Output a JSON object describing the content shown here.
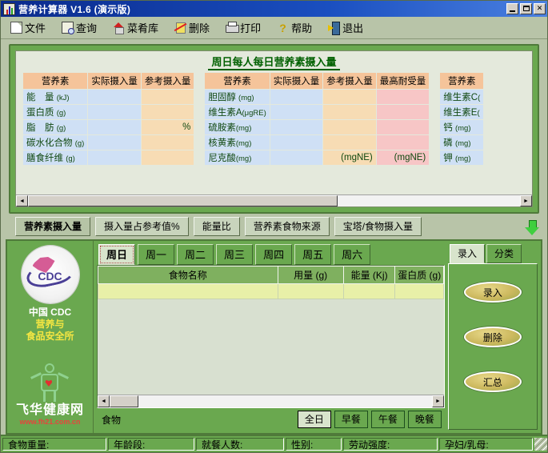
{
  "window": {
    "title": "营养计算器 V1.6 (演示版)",
    "icon": "chart-bars-icon",
    "controls": [
      {
        "name": "minimize-button",
        "label": "_"
      },
      {
        "name": "maximize-button",
        "label": "□"
      },
      {
        "name": "close-button",
        "label": "✕"
      }
    ]
  },
  "toolbar": {
    "items": [
      {
        "label": "文件",
        "icon": "file-icon"
      },
      {
        "label": "查询",
        "icon": "search-document-icon"
      },
      {
        "label": "菜肴库",
        "icon": "dish-library-icon"
      },
      {
        "label": "删除",
        "icon": "delete-icon"
      },
      {
        "label": "打印",
        "icon": "printer-icon"
      },
      {
        "label": "帮助",
        "icon": "help-icon"
      },
      {
        "label": "退出",
        "icon": "exit-icon"
      }
    ]
  },
  "nutrition_panel": {
    "title": "周日每人每日营养素摄入量",
    "tables": [
      {
        "headers": [
          "营养素",
          "实际摄入量",
          "参考摄入量"
        ],
        "rows": [
          {
            "name": "能　量",
            "unit": "(kJ)",
            "actual": "",
            "reference": ""
          },
          {
            "name": "蛋白质",
            "unit": "(g)",
            "actual": "",
            "reference": ""
          },
          {
            "name": "脂　肪",
            "unit": "(g)",
            "actual": "",
            "reference": "%"
          },
          {
            "name": "碳水化合物",
            "unit": "(g)",
            "actual": "",
            "reference": ""
          },
          {
            "name": "膳食纤维",
            "unit": "(g)",
            "actual": "",
            "reference": ""
          }
        ]
      },
      {
        "headers": [
          "营养素",
          "实际摄入量",
          "参考摄入量",
          "最高耐受量"
        ],
        "rows": [
          {
            "name": "胆固醇",
            "unit": "(mg)",
            "actual": "",
            "reference": "",
            "max": ""
          },
          {
            "name": "维生素A",
            "unit": "(μgRE)",
            "actual": "",
            "reference": "",
            "max": ""
          },
          {
            "name": "硫胺素",
            "unit": "(mg)",
            "actual": "",
            "reference": "",
            "max": ""
          },
          {
            "name": "核黄素",
            "unit": "(mg)",
            "actual": "",
            "reference": "",
            "max": ""
          },
          {
            "name": "尼克酸",
            "unit": "(mg)",
            "actual": "",
            "reference": "(mgNE)",
            "max": "(mgNE)"
          }
        ]
      },
      {
        "headers": [
          "营养素"
        ],
        "rows": [
          {
            "name": "维生素C",
            "unit": "("
          },
          {
            "name": "维生素E",
            "unit": "("
          },
          {
            "name": "钙",
            "unit": "(mg)"
          },
          {
            "name": "磷",
            "unit": "(mg)"
          },
          {
            "name": "钾",
            "unit": "(mg)"
          }
        ]
      }
    ],
    "scrollbar": {
      "left_arrow": "◄",
      "right_arrow": "►"
    }
  },
  "section_tabs": {
    "items": [
      {
        "label": "营养素摄入量",
        "active": true
      },
      {
        "label": "摄入量占参考值%",
        "active": false
      },
      {
        "label": "能量比",
        "active": false
      },
      {
        "label": "营养素食物来源",
        "active": false
      },
      {
        "label": "宝塔/食物摄入量",
        "active": false
      }
    ],
    "expand_icon": "down-arrow-icon"
  },
  "logo_panel": {
    "badge_text": "CDC",
    "caption_line1": "中国 CDC",
    "caption_line2": "营养与",
    "caption_line3": "食品安全所",
    "site_name": "飞华健康网",
    "site_url": "www.fh21.com.cn"
  },
  "day_tabs": {
    "items": [
      {
        "label": "周日",
        "active": true
      },
      {
        "label": "周一",
        "active": false
      },
      {
        "label": "周二",
        "active": false
      },
      {
        "label": "周三",
        "active": false
      },
      {
        "label": "周四",
        "active": false
      },
      {
        "label": "周五",
        "active": false
      },
      {
        "label": "周六",
        "active": false
      }
    ]
  },
  "food_grid": {
    "headers": [
      "食物名称",
      "用量 (g)",
      "能量 (Kj)",
      "蛋白质 (g)"
    ],
    "rows": [
      {
        "food": "",
        "amount": "",
        "energy": "",
        "protein": ""
      }
    ]
  },
  "meal_bar": {
    "label": "食物",
    "buttons": [
      {
        "label": "全日",
        "active": true
      },
      {
        "label": "早餐",
        "active": false
      },
      {
        "label": "午餐",
        "active": false
      },
      {
        "label": "晚餐",
        "active": false
      }
    ]
  },
  "right_panel": {
    "tabs": [
      {
        "label": "录入",
        "active": true
      },
      {
        "label": "分类",
        "active": false
      }
    ],
    "buttons": [
      {
        "label": "录入"
      },
      {
        "label": "删除"
      },
      {
        "label": "汇总"
      }
    ]
  },
  "statusbar": {
    "cells": [
      {
        "label": "食物重量:",
        "width": 130
      },
      {
        "label": "年龄段:",
        "width": 108
      },
      {
        "label": "就餐人数:",
        "width": 110
      },
      {
        "label": "性别:",
        "width": 70
      },
      {
        "label": "劳动强度:",
        "width": 118
      },
      {
        "label": "孕妇/乳母:",
        "width": 128
      }
    ]
  },
  "colors": {
    "titlebar": "#0a2a8c",
    "panel_green": "#6aa84f",
    "frame_green": "#4f7a3a",
    "toolbar_bg": "#b8c4a8",
    "table_header": "#f5c49a",
    "table_cell_blue": "#cfe0f5",
    "table_cell_peach": "#f7dcb4",
    "table_cell_pink": "#f7c6c6",
    "grid_row": "#e8f0a8",
    "grid_header": "#7fb05f",
    "title_text_green": "#006000"
  }
}
